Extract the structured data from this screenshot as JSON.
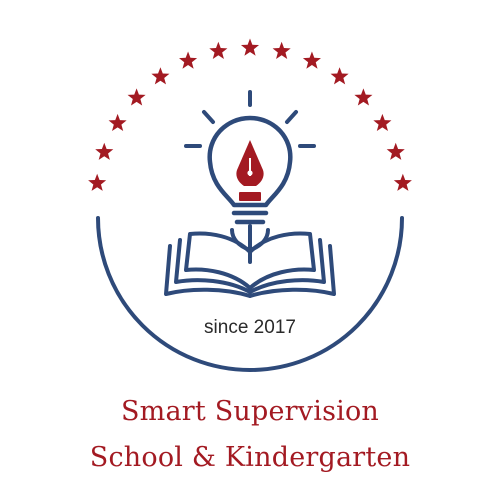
{
  "logo": {
    "tagline": "since 2017",
    "name_line_1": "Smart Supervision",
    "name_line_2": "School & Kindergarten",
    "star_count": 15,
    "icon_names": [
      "star-icon",
      "light-bulb-icon",
      "fountain-pen-nib-icon",
      "open-book-icon"
    ]
  },
  "colors": {
    "navy": "#2e4a7a",
    "red": "#a31a22",
    "background": "#ffffff",
    "tagline": "#2a2a2a"
  }
}
